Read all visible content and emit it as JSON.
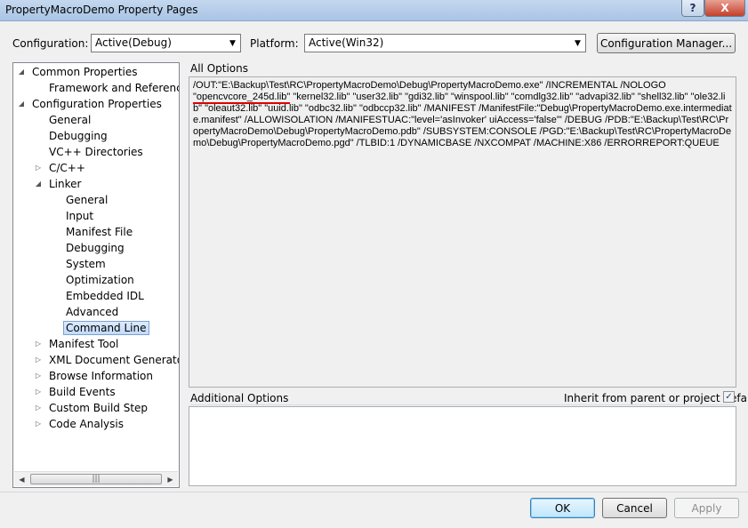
{
  "window": {
    "title": "PropertyMacroDemo Property Pages",
    "help_glyph": "?",
    "close_glyph": "X"
  },
  "config": {
    "configuration_label": "Configuration:",
    "configuration_value": "Active(Debug)",
    "platform_label": "Platform:",
    "platform_value": "Active(Win32)",
    "manager_button": "Configuration Manager..."
  },
  "tree": [
    {
      "label": "Common Properties",
      "expander": "◢"
    },
    {
      "label": "Framework and References",
      "expander": ""
    },
    {
      "label": "Configuration Properties",
      "expander": "◢"
    },
    {
      "label": "General",
      "expander": ""
    },
    {
      "label": "Debugging",
      "expander": ""
    },
    {
      "label": "VC++ Directories",
      "expander": ""
    },
    {
      "label": "C/C++",
      "expander": "▷"
    },
    {
      "label": "Linker",
      "expander": "◢"
    },
    {
      "label": "General",
      "expander": ""
    },
    {
      "label": "Input",
      "expander": ""
    },
    {
      "label": "Manifest File",
      "expander": ""
    },
    {
      "label": "Debugging",
      "expander": ""
    },
    {
      "label": "System",
      "expander": ""
    },
    {
      "label": "Optimization",
      "expander": ""
    },
    {
      "label": "Embedded IDL",
      "expander": ""
    },
    {
      "label": "Advanced",
      "expander": ""
    },
    {
      "label": "Command Line",
      "expander": ""
    },
    {
      "label": "Manifest Tool",
      "expander": "▷"
    },
    {
      "label": "XML Document Generator",
      "expander": "▷"
    },
    {
      "label": "Browse Information",
      "expander": "▷"
    },
    {
      "label": "Build Events",
      "expander": "▷"
    },
    {
      "label": "Custom Build Step",
      "expander": "▷"
    },
    {
      "label": "Code Analysis",
      "expander": "▷"
    }
  ],
  "tree_selected": "Command Line",
  "tree_scroll": {
    "left_arrow": "◀",
    "right_arrow": "▶",
    "grip": "|||"
  },
  "all_options": {
    "label": "All Options",
    "text_before": "/OUT:\"E:\\Backup\\Test\\RC\\PropertyMacroDemo\\Debug\\PropertyMacroDemo.exe\" /INCREMENTAL /NOLOGO\n",
    "highlighted": "\"opencvcore_245d.lib\"",
    "text_after": " \"kernel32.lib\" \"user32.lib\" \"gdi32.lib\" \"winspool.lib\" \"comdlg32.lib\" \"advapi32.lib\" \"shell32.lib\" \"ole32.lib\" \"oleaut32.lib\" \"uuid.lib\" \"odbc32.lib\" \"odbccp32.lib\" /MANIFEST /ManifestFile:\"Debug\\PropertyMacroDemo.exe.intermediate.manifest\" /ALLOWISOLATION /MANIFESTUAC:\"level='asInvoker' uiAccess='false'\" /DEBUG /PDB:\"E:\\Backup\\Test\\RC\\PropertyMacroDemo\\Debug\\PropertyMacroDemo.pdb\" /SUBSYSTEM:CONSOLE /PGD:\"E:\\Backup\\Test\\RC\\PropertyMacroDemo\\Debug\\PropertyMacroDemo.pgd\" /TLBID:1 /DYNAMICBASE /NXCOMPAT /MACHINE:X86 /ERRORREPORT:QUEUE"
  },
  "additional": {
    "label": "Additional Options",
    "inherit_label": "Inherit from parent or project defaults",
    "inherit_checked": "✓",
    "value": ""
  },
  "buttons": {
    "ok": "OK",
    "cancel": "Cancel",
    "apply": "Apply"
  }
}
